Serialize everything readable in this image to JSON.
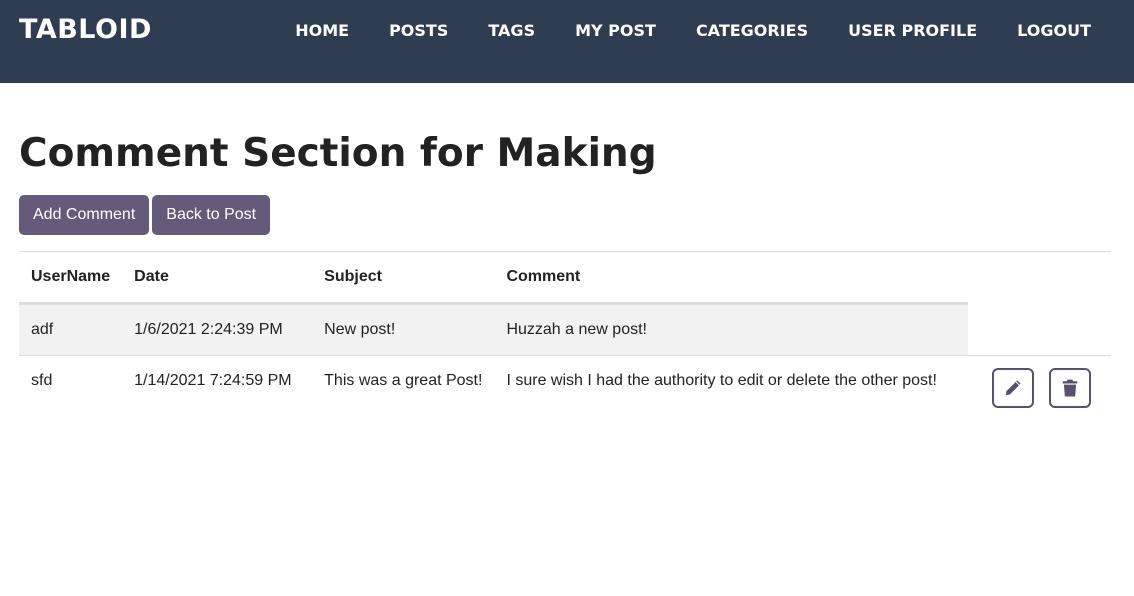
{
  "app": {
    "brand": "TABLOID"
  },
  "nav": {
    "items": [
      {
        "label": "HOME"
      },
      {
        "label": "POSTS"
      },
      {
        "label": "TAGS"
      },
      {
        "label": "MY POST"
      },
      {
        "label": "CATEGORIES"
      },
      {
        "label": "USER PROFILE"
      },
      {
        "label": "LOGOUT"
      }
    ]
  },
  "page": {
    "title": "Comment Section for Making"
  },
  "actions": {
    "add_comment_label": "Add Comment",
    "back_to_post_label": "Back to Post"
  },
  "table": {
    "columns": [
      "UserName",
      "Date",
      "Subject",
      "Comment"
    ],
    "rows": [
      {
        "username": "adf",
        "date": "1/6/2021 2:24:39 PM",
        "subject": "New post!",
        "comment": "Huzzah a new post!",
        "has_actions": false
      },
      {
        "username": "sfd",
        "date": "1/14/2021 7:24:59 PM",
        "subject": "This was a great Post!",
        "comment": "I sure wish I had the authority to edit or delete the other post!",
        "has_actions": true,
        "edit_icon": "pencil-icon",
        "delete_icon": "trash-icon"
      }
    ]
  },
  "colors": {
    "navbar_bg": "#2e3d52",
    "button_bg": "#665a7a",
    "icon_border": "#5a4f6e",
    "row_striped_bg": "#f2f2f2"
  }
}
